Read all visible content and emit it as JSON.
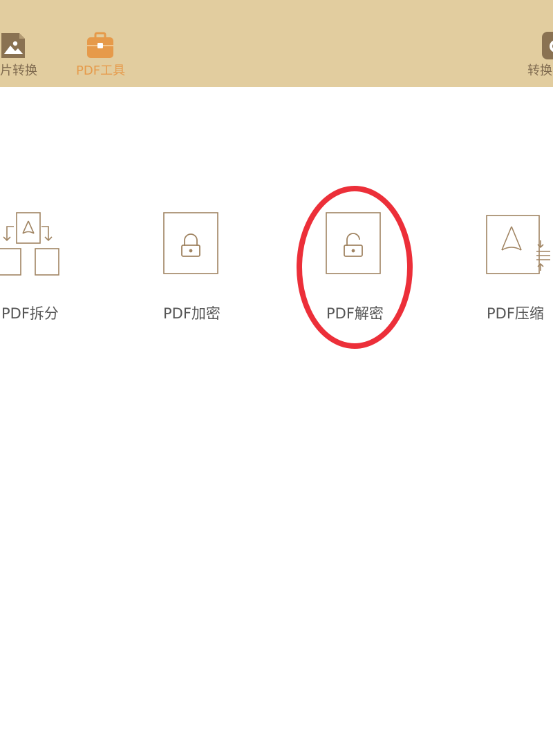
{
  "topbar": {
    "background": "#e2cd9f",
    "items": [
      {
        "label": "片转换",
        "icon": "image-icon",
        "active": false
      },
      {
        "label": "PDF工具",
        "icon": "briefcase-icon",
        "active": true
      },
      {
        "label": "转换",
        "icon": "history-icon",
        "active": false
      }
    ],
    "active_color": "#e69a4a"
  },
  "tools": [
    {
      "label": "PDF拆分",
      "icon": "pdf-split-icon"
    },
    {
      "label": "PDF加密",
      "icon": "lock-icon"
    },
    {
      "label": "PDF解密",
      "icon": "unlock-icon"
    },
    {
      "label": "PDF压缩",
      "icon": "pdf-compress-icon"
    }
  ],
  "annotation": {
    "shape": "ellipse",
    "color": "#ec2f39",
    "target": "PDF解密"
  }
}
